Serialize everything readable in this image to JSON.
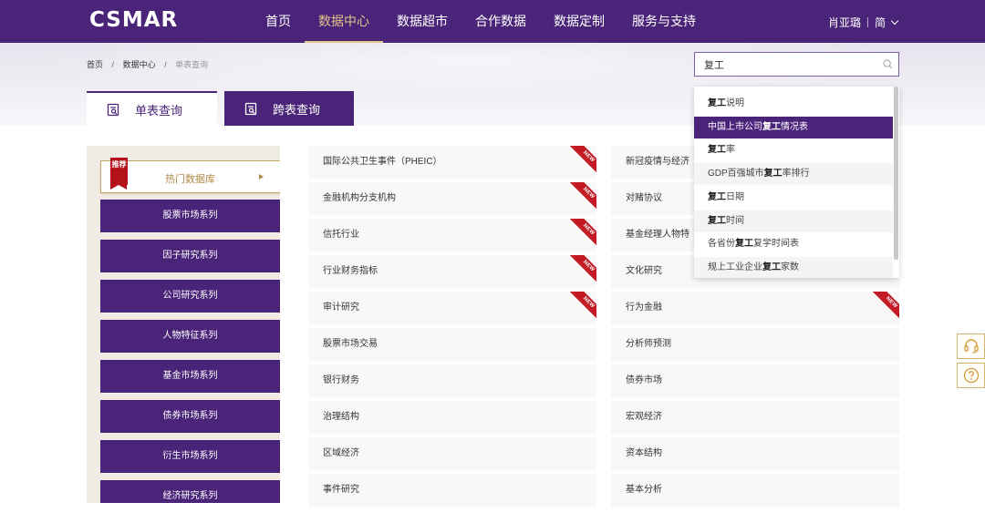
{
  "header": {
    "logo": "CSMAR",
    "nav": [
      "首页",
      "数据中心",
      "数据超市",
      "合作数据",
      "数据定制",
      "服务与支持"
    ],
    "active_nav": "数据中心",
    "user_name": "肖亚璐",
    "lang": "简"
  },
  "breadcrumb": {
    "home": "首页",
    "sep": "/",
    "section": "数据中心",
    "current": "单表查询"
  },
  "search": {
    "value": "复工"
  },
  "tabs": {
    "single": "单表查询",
    "cross": "跨表查询"
  },
  "sidebar": {
    "badge": "推荐",
    "hot": "热门数据库",
    "items": [
      "股票市场系列",
      "因子研究系列",
      "公司研究系列",
      "人物特征系列",
      "基金市场系列",
      "债券市场系列",
      "衍生市场系列",
      "经济研究系列"
    ]
  },
  "ribbon_label": "NEW",
  "grid": {
    "col1": [
      {
        "label": "国际公共卫生事件（PHEIC）",
        "new": true
      },
      {
        "label": "金融机构分支机构",
        "new": true
      },
      {
        "label": "信托行业",
        "new": true
      },
      {
        "label": "行业财务指标",
        "new": true
      },
      {
        "label": "审计研究",
        "new": true
      },
      {
        "label": "股票市场交易",
        "new": false
      },
      {
        "label": "银行财务",
        "new": false
      },
      {
        "label": "治理结构",
        "new": false
      },
      {
        "label": "区域经济",
        "new": false
      },
      {
        "label": "事件研究",
        "new": false
      }
    ],
    "col2": [
      {
        "label": "新冠疫情与经济",
        "new": false
      },
      {
        "label": "对赌协议",
        "new": false
      },
      {
        "label": "基金经理人物特",
        "new": false
      },
      {
        "label": "文化研究",
        "new": false
      },
      {
        "label": "行为金融",
        "new": true
      },
      {
        "label": "分析师预测",
        "new": false
      },
      {
        "label": "债券市场",
        "new": false
      },
      {
        "label": "宏观经济",
        "new": false
      },
      {
        "label": "资本结构",
        "new": false
      },
      {
        "label": "基本分析",
        "new": false
      }
    ]
  },
  "suggestions": [
    {
      "pre": "",
      "kw": "复工",
      "post": "说明"
    },
    {
      "pre": "中国上市公司",
      "kw": "复工",
      "post": "情况表"
    },
    {
      "pre": "",
      "kw": "复工",
      "post": "率"
    },
    {
      "pre": "GDP百强城市",
      "kw": "复工",
      "post": "率排行"
    },
    {
      "pre": "",
      "kw": "复工",
      "post": "日期"
    },
    {
      "pre": "",
      "kw": "复工",
      "post": "时间"
    },
    {
      "pre": "各省份",
      "kw": "复工",
      "post": "复学时间表"
    },
    {
      "pre": "规上工业企业",
      "kw": "复工",
      "post": "家数"
    }
  ],
  "suggestion_highlight_index": 1,
  "colors": {
    "brand": "#4a2479",
    "gold": "#c9a468",
    "ribbon": "#c41a26"
  },
  "icons": [
    "search-icon",
    "single-table-icon",
    "cross-table-icon",
    "headset-icon",
    "help-icon",
    "chevron-down-icon"
  ]
}
